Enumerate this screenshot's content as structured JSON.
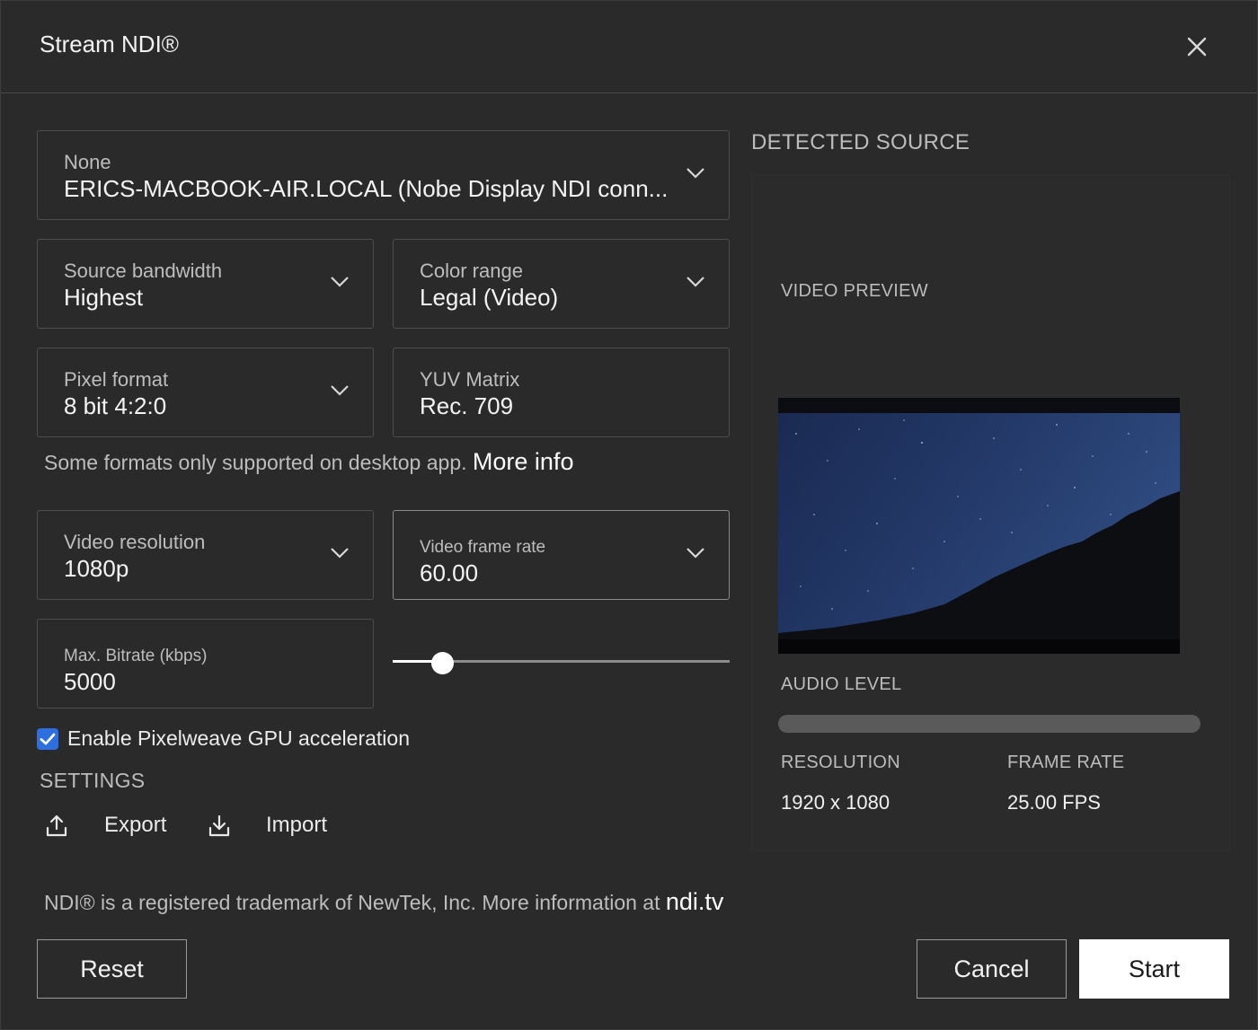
{
  "dialog": {
    "title": "Stream NDI®",
    "close_icon": "close-icon"
  },
  "source": {
    "label": "None",
    "value": "ERICS-MACBOOK-AIR.LOCAL (Nobe Display NDI conn..."
  },
  "bandwidth": {
    "label": "Source bandwidth",
    "value": "Highest"
  },
  "color_range": {
    "label": "Color range",
    "value": "Legal (Video)"
  },
  "pixel_format": {
    "label": "Pixel format",
    "value": "8 bit 4:2:0"
  },
  "yuv_matrix": {
    "label": "YUV Matrix",
    "value": "Rec. 709"
  },
  "formats_note": {
    "text": "Some formats only supported on desktop app.",
    "link": "More info"
  },
  "resolution": {
    "label": "Video resolution",
    "value": "1080p"
  },
  "frame_rate": {
    "label": "Video frame rate",
    "value": "60.00"
  },
  "bitrate": {
    "label": "Max. Bitrate (kbps)",
    "value": "5000",
    "slider_fraction": 0.15
  },
  "gpu": {
    "label": "Enable Pixelweave GPU acceleration",
    "checked": true
  },
  "settings": {
    "heading": "SETTINGS",
    "export_label": "Export",
    "import_label": "Import"
  },
  "footer": {
    "note": "NDI® is a registered trademark of NewTek, Inc. More information at",
    "link": "ndi.tv"
  },
  "buttons": {
    "reset": "Reset",
    "cancel": "Cancel",
    "start": "Start"
  },
  "detected": {
    "heading": "DETECTED SOURCE",
    "preview_label": "VIDEO PREVIEW",
    "audio_label": "AUDIO LEVEL",
    "resolution_label": "RESOLUTION",
    "resolution_value": "1920 x 1080",
    "framerate_label": "FRAME RATE",
    "framerate_value": "25.00 FPS"
  },
  "colors": {
    "accent": "#2e6fe0",
    "background": "#2a2a2a"
  }
}
